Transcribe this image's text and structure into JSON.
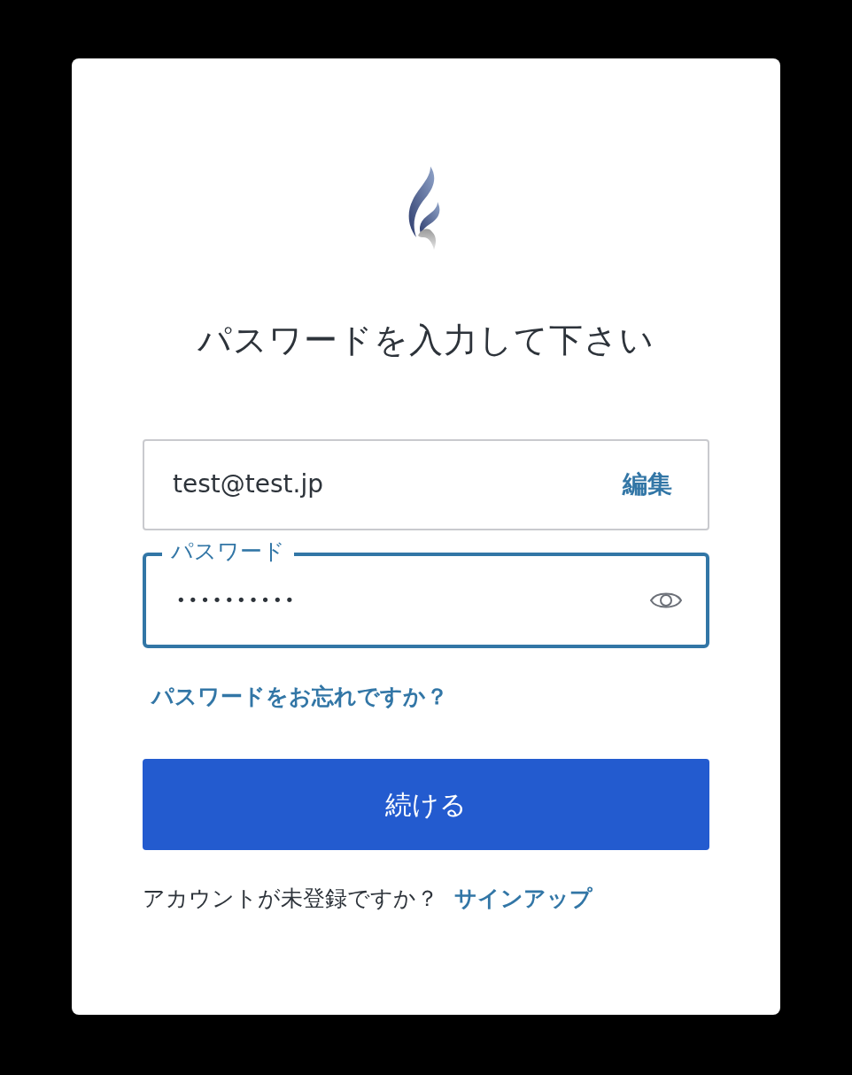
{
  "title": "パスワードを入力して下さい",
  "email": {
    "value": "test@test.jp",
    "edit_label": "編集"
  },
  "password": {
    "label": "パスワード",
    "value": "••••••••••",
    "focused": true
  },
  "forgot_link": "パスワードをお忘れですか？",
  "continue_button": "続ける",
  "signup": {
    "prompt": "アカウントが未登録ですか？",
    "link": "サインアップ"
  }
}
